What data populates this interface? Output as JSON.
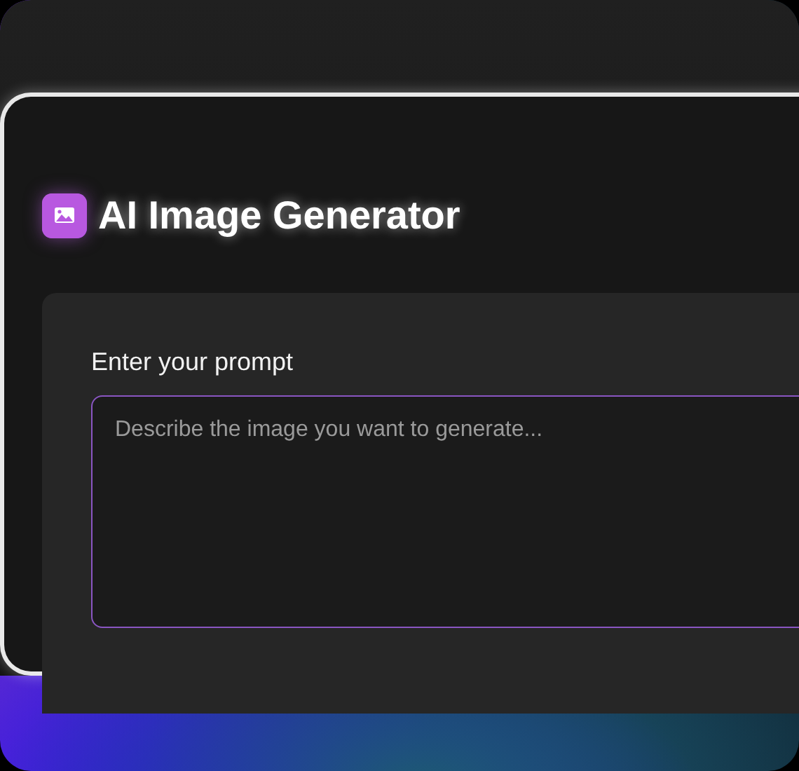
{
  "header": {
    "title": "AI Image Generator"
  },
  "prompt": {
    "label": "Enter your prompt",
    "placeholder": "Describe the image you want to generate..."
  }
}
